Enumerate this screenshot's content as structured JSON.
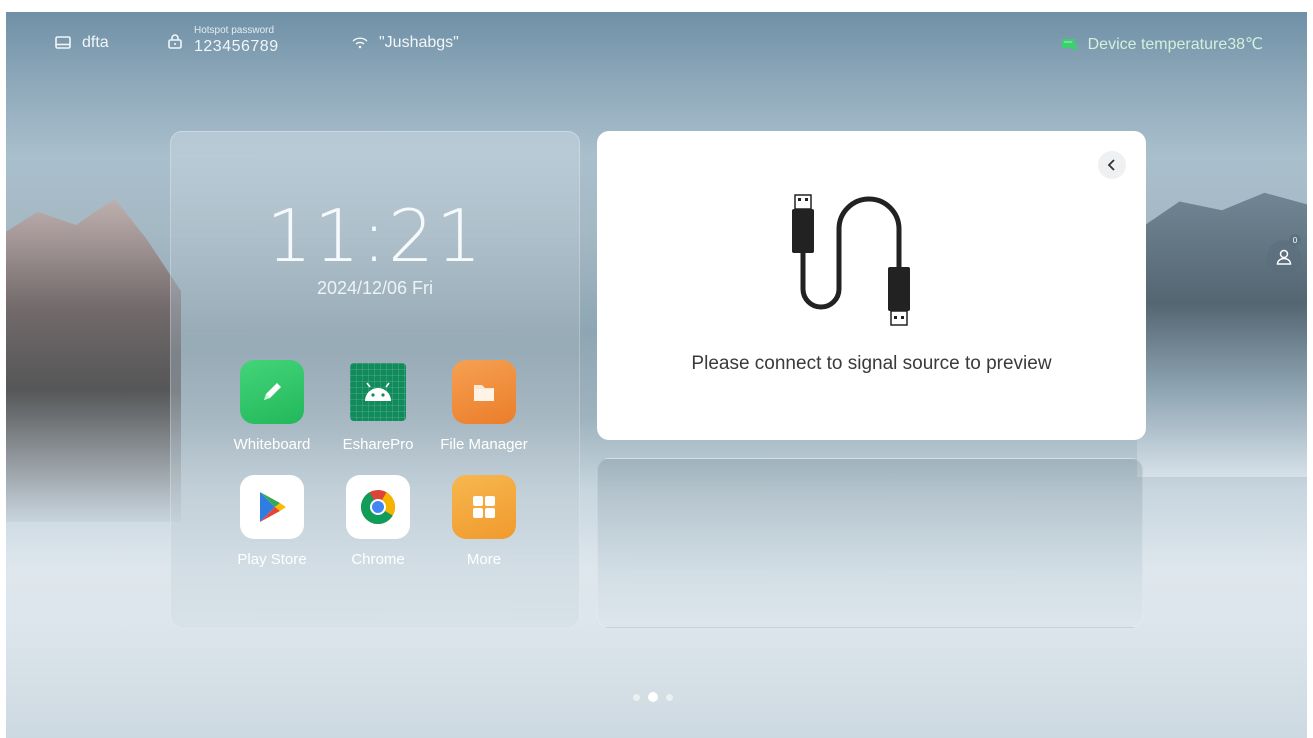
{
  "statusbar": {
    "device_name": "dfta",
    "hotspot_label": "Hotspot password",
    "hotspot_password": "123456789",
    "wifi_name": "\"Jushabgs\"",
    "temperature": "Device temperature38℃"
  },
  "clock": {
    "time": "11:21",
    "date": "2024/12/06 Fri"
  },
  "apps": [
    {
      "label": "Whiteboard",
      "icon": "pencil-icon"
    },
    {
      "label": "EsharePro",
      "icon": "android-icon"
    },
    {
      "label": "File Manager",
      "icon": "folder-icon"
    },
    {
      "label": "Play Store",
      "icon": "play-store-icon"
    },
    {
      "label": "Chrome",
      "icon": "chrome-icon"
    },
    {
      "label": "More",
      "icon": "grid-icon"
    }
  ],
  "preview": {
    "message": "Please connect to signal source to preview"
  },
  "user": {
    "badge": "0"
  },
  "pager": {
    "pages": 3,
    "current": 2
  },
  "colors": {
    "temp_ok": "#3bd16f",
    "whiteboard": "#2ec866",
    "eshare": "#118a5c",
    "file_manager": "#ef8a36",
    "more": "#f2a93a"
  }
}
